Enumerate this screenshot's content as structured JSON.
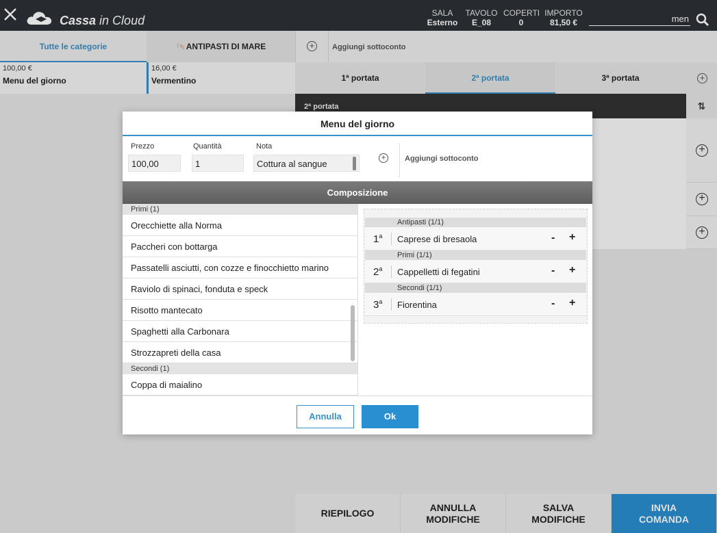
{
  "header": {
    "app_name_bold": "Cassa",
    "app_name_light": " in Cloud",
    "sala_label": "SALA",
    "sala_value": "Esterno",
    "tavolo_label": "TAVOLO",
    "tavolo_value": "E_08",
    "coperti_label": "COPERTI",
    "coperti_value": "0",
    "importo_label": "IMPORTO",
    "importo_value": "81,50 €",
    "search_value": "men"
  },
  "categories": {
    "all_label": "Tutte le categorie",
    "mare_label": "ANTIPASTI DI MARE"
  },
  "products": [
    {
      "price": "100,00 €",
      "name": "Menu del giorno"
    },
    {
      "price": "16,00 €",
      "name": "Vermentino"
    }
  ],
  "right": {
    "add_subconto": "Aggiungi sottoconto",
    "courses": [
      "1ª portata",
      "2ª portata",
      "3ª portata"
    ],
    "active_course": 1,
    "section_title": "2ª portata"
  },
  "bottom": {
    "riepilogo": "RIEPILOGO",
    "annulla_1": "ANNULLA",
    "annulla_2": "MODIFICHE",
    "salva_1": "SALVA",
    "salva_2": "MODIFICHE",
    "invia_1": "INVIA",
    "invia_2": "COMANDA"
  },
  "modal": {
    "title": "Menu del giorno",
    "prezzo_label": "Prezzo",
    "prezzo_value": "100,00",
    "quantita_label": "Quantità",
    "quantita_value": "1",
    "nota_label": "Nota",
    "nota_value": "Cottura al sangue",
    "add_subconto": "Aggiungi sottoconto",
    "composizione": "Composizione",
    "groups": [
      {
        "header": "Primi (1)",
        "items": [
          "Orecchiette alla Norma",
          "Paccheri con bottarga",
          "Passatelli asciutti, con cozze e finocchietto marino",
          "Raviolo di spinaci, fonduta e speck",
          "Risotto mantecato",
          "Spaghetti alla Carbonara",
          "Strozzapreti della casa"
        ]
      },
      {
        "header": "Secondi (1)",
        "items": [
          "Coppa di maialino"
        ]
      }
    ],
    "selected": [
      {
        "group": "Antipasti (1/1)",
        "num": "1",
        "sup": "a",
        "name": "Caprese di bresaola"
      },
      {
        "group": "Primi (1/1)",
        "num": "2",
        "sup": "a",
        "name": "Cappelletti di fegatini"
      },
      {
        "group": "Secondi (1/1)",
        "num": "3",
        "sup": "a",
        "name": "Fiorentina"
      }
    ],
    "minus": "-",
    "plus": "+",
    "annulla": "Annulla",
    "ok": "Ok"
  },
  "icons": {
    "close": "close-icon",
    "search": "search-icon",
    "cloud": "cloud-logo-icon",
    "plus": "plus-circle-icon",
    "sort": "sort-icon"
  },
  "colors": {
    "accent": "#3a8fc7",
    "header_bg": "#2d3136",
    "invia_bg": "#2a8fd0"
  }
}
